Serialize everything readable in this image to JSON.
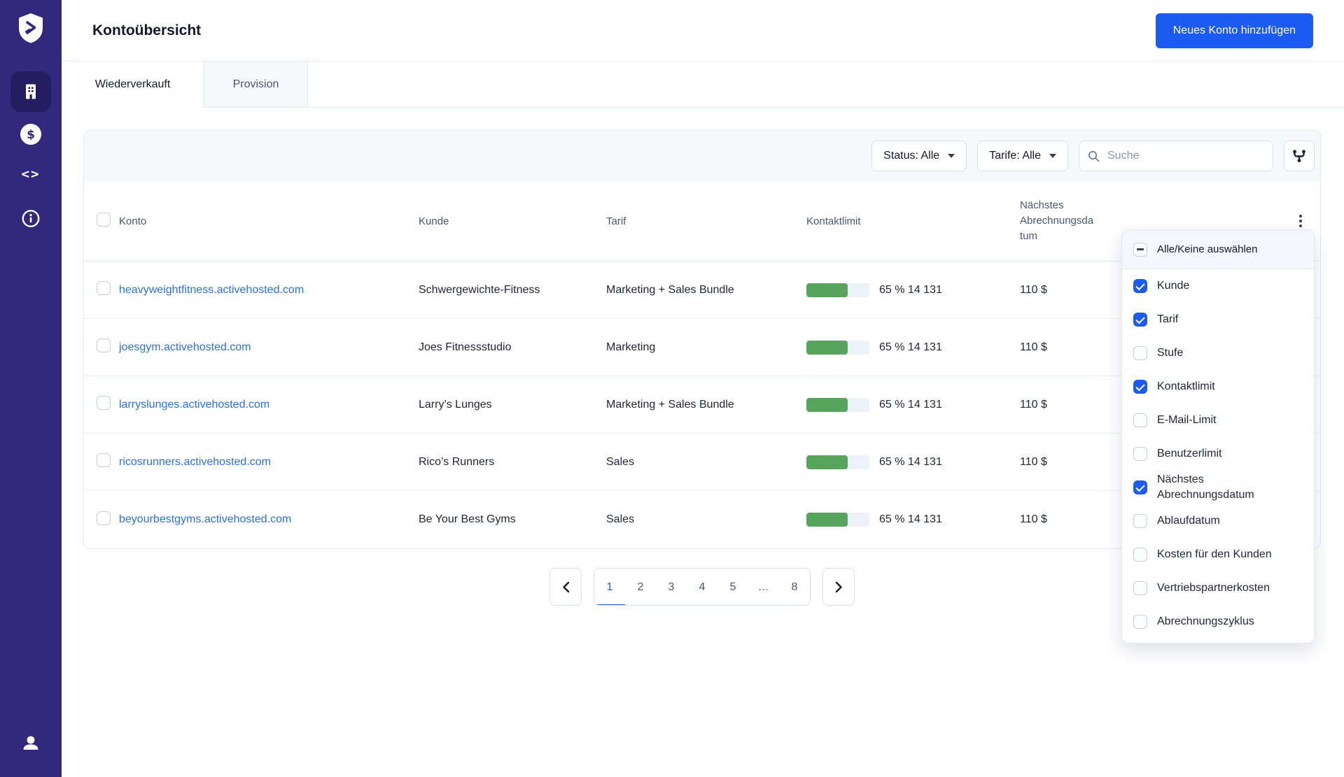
{
  "colors": {
    "accent": "#1D5BF0",
    "link": "#2A6FF0",
    "green": "#57A45C",
    "sidebar": "#32297F",
    "sidebar_active": "#241C5E"
  },
  "sidebar": {
    "logo_icon": "shield-arrow-logo",
    "items": [
      {
        "id": "accounts",
        "icon": "building-icon",
        "active": true
      },
      {
        "id": "billing",
        "icon": "dollar-icon",
        "active": false
      },
      {
        "id": "developer",
        "icon": "code-icon",
        "active": false
      },
      {
        "id": "info",
        "icon": "info-icon",
        "active": false
      }
    ],
    "footer_icon": "user-icon",
    "code_glyph": "<>"
  },
  "header": {
    "title": "Kontoübersicht",
    "add_button": "Neues Konto hinzufügen"
  },
  "tabs": [
    {
      "label": "Wiederverkauft",
      "active": true
    },
    {
      "label": "Provision",
      "active": false
    }
  ],
  "filters": {
    "status": "Status: Alle",
    "tarife": "Tarife: Alle",
    "search_placeholder": "Suche",
    "columns_button_icon": "columns-merge-icon"
  },
  "table": {
    "columns": [
      "Konto",
      "Kunde",
      "Tarif",
      "Kontaktlimit",
      "Nächstes Abrechnungsdatum"
    ],
    "rows": [
      {
        "konto": "heavyweightfitness.activehosted.com",
        "kunde": "Schwergewichte-Fitness",
        "tarif": "Marketing + Sales Bundle",
        "limit_percent": 65,
        "limit_label": "65 % 14 131",
        "price": "110 $"
      },
      {
        "konto": "joesgym.activehosted.com",
        "kunde": "Joes Fitnessstudio",
        "tarif": "Marketing",
        "limit_percent": 65,
        "limit_label": "65 % 14 131",
        "price": "110 $"
      },
      {
        "konto": "larryslunges.activehosted.com",
        "kunde": "Larry’s Lunges",
        "tarif": "Marketing + Sales Bundle",
        "limit_percent": 65,
        "limit_label": "65 % 14 131",
        "price": "110 $"
      },
      {
        "konto": "ricosrunners.activehosted.com",
        "kunde": "Rico’s Runners",
        "tarif": "Sales",
        "limit_percent": 65,
        "limit_label": "65 % 14 131",
        "price": "110 $"
      },
      {
        "konto": "beyourbestgyms.activehosted.com",
        "kunde": "Be Your Best Gyms",
        "tarif": "Sales",
        "limit_percent": 65,
        "limit_label": "65 % 14 131",
        "price": "110 $"
      }
    ]
  },
  "pagination": {
    "prev_icon": "chevron-left",
    "next_icon": "chevron-right",
    "pages": [
      "1",
      "2",
      "3",
      "4",
      "5",
      "…",
      "8"
    ],
    "active": "1"
  },
  "column_menu": {
    "select_all": {
      "label": "Alle/Keine auswählen",
      "state": "indeterminate"
    },
    "items": [
      {
        "label": "Kunde",
        "checked": true
      },
      {
        "label": "Tarif",
        "checked": true
      },
      {
        "label": "Stufe",
        "checked": false
      },
      {
        "label": "Kontaktlimit",
        "checked": true
      },
      {
        "label": "E-Mail-Limit",
        "checked": false
      },
      {
        "label": "Benutzerlimit",
        "checked": false
      },
      {
        "label": "Nächstes Abrechnungsdatum",
        "checked": true
      },
      {
        "label": "Ablaufdatum",
        "checked": false
      },
      {
        "label": "Kosten für den Kunden",
        "checked": false
      },
      {
        "label": "Vertriebspartnerkosten",
        "checked": false
      },
      {
        "label": "Abrechnungszyklus",
        "checked": false
      }
    ]
  }
}
